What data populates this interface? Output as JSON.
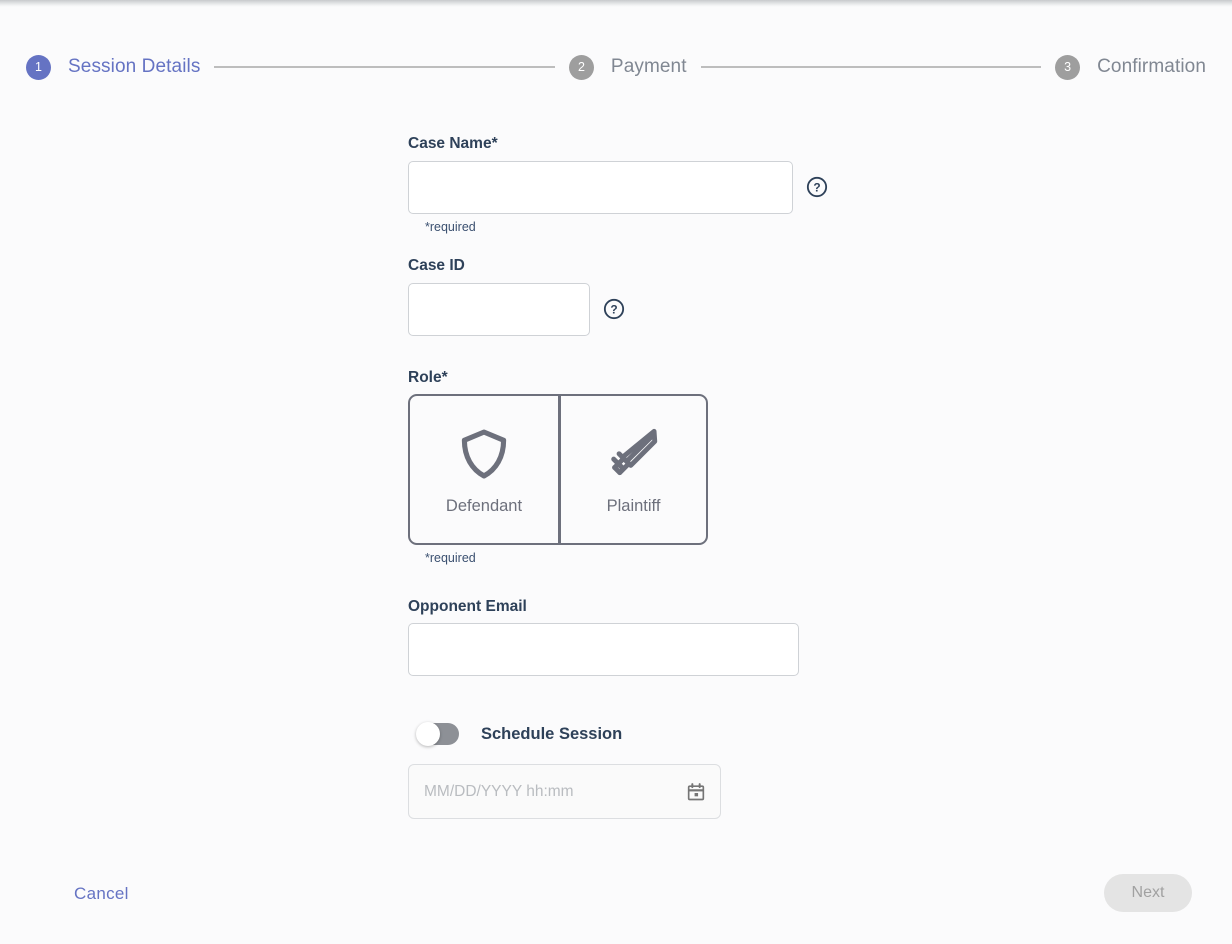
{
  "stepper": {
    "steps": [
      {
        "number": "1",
        "label": "Session Details",
        "state": "active"
      },
      {
        "number": "2",
        "label": "Payment",
        "state": "inactive"
      },
      {
        "number": "3",
        "label": "Confirmation",
        "state": "inactive"
      }
    ],
    "active_color": "#6573c3",
    "inactive_color": "#9e9e9e",
    "connector_color": "#bdbdbd"
  },
  "form": {
    "case_name": {
      "label": "Case Name*",
      "value": "",
      "placeholder": "",
      "help_icon": "help-circle-icon",
      "note": "*required"
    },
    "case_id": {
      "label": "Case ID",
      "value": "",
      "placeholder": "",
      "help_icon": "help-circle-icon"
    },
    "role": {
      "label": "Role*",
      "note": "*required",
      "options": [
        {
          "label": "Defendant",
          "icon": "shield-icon"
        },
        {
          "label": "Plaintiff",
          "icon": "sword-icon"
        }
      ],
      "selected": "",
      "border_color": "#6d707c"
    },
    "opponent_email": {
      "label": "Opponent Email",
      "value": "",
      "placeholder": ""
    },
    "schedule": {
      "toggle_label": "Schedule Session",
      "toggle_state": "off",
      "date_value": "",
      "date_placeholder": "MM/DD/YYYY hh:mm",
      "calendar_icon": "calendar-icon",
      "disabled": "true"
    }
  },
  "footer": {
    "cancel_label": "Cancel",
    "next_label": "Next",
    "next_state": "disabled",
    "cancel_color": "#6573c3"
  }
}
